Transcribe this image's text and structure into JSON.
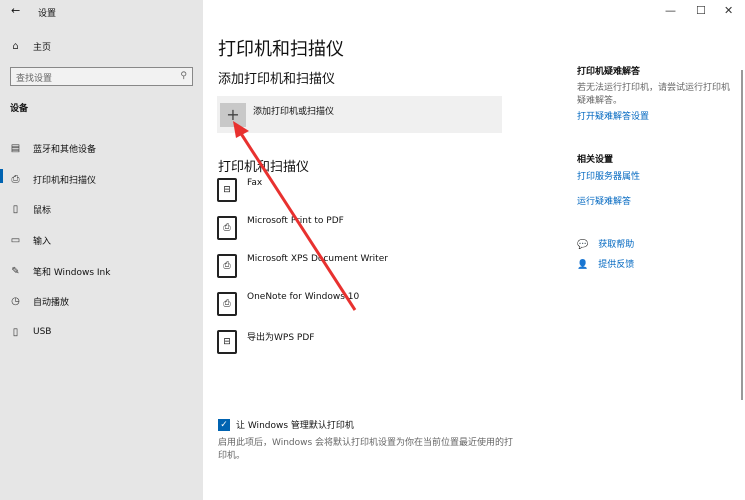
{
  "window": {
    "title": "设置",
    "minimize": "—",
    "maximize": "☐",
    "close": "✕"
  },
  "sidebar": {
    "back": "←",
    "home": "主页",
    "search_placeholder": "查找设置",
    "section": "设备",
    "items": [
      {
        "label": "蓝牙和其他设备",
        "icon": "bluetooth-devices-icon",
        "glyph": "▤"
      },
      {
        "label": "打印机和扫描仪",
        "icon": "printer-icon",
        "glyph": "⎙",
        "selected": true
      },
      {
        "label": "鼠标",
        "icon": "mouse-icon",
        "glyph": "▯"
      },
      {
        "label": "输入",
        "icon": "keyboard-icon",
        "glyph": "▭"
      },
      {
        "label": "笔和 Windows Ink",
        "icon": "pen-icon",
        "glyph": "✎"
      },
      {
        "label": "自动播放",
        "icon": "autoplay-icon",
        "glyph": "◷"
      },
      {
        "label": "USB",
        "icon": "usb-icon",
        "glyph": "▯"
      }
    ]
  },
  "main": {
    "title": "打印机和扫描仪",
    "add_section": "添加打印机和扫描仪",
    "add_label": "添加打印机或扫描仪",
    "list_section": "打印机和扫描仪",
    "printers": [
      {
        "name": "Fax",
        "icon": "fax-printer-icon"
      },
      {
        "name": "Microsoft Print to PDF",
        "icon": "document-printer-icon"
      },
      {
        "name": "Microsoft XPS Document Writer",
        "icon": "document-printer-icon"
      },
      {
        "name": "OneNote for Windows 10",
        "icon": "document-printer-icon"
      },
      {
        "name": "导出为WPS PDF",
        "icon": "printer-icon"
      }
    ],
    "default_checkbox": {
      "label": "让 Windows 管理默认打印机",
      "checked": true
    },
    "default_desc": "启用此项后，Windows 会将默认打印机设置为你在当前位置最近使用的打印机。"
  },
  "right": {
    "trouble_title": "打印机疑难解答",
    "trouble_desc": "若无法运行打印机，请尝试运行打印机疑难解答。",
    "trouble_link": "打开疑难解答设置",
    "related_title": "相关设置",
    "related_links": [
      "打印服务器属性",
      "运行疑难解答"
    ],
    "help": "获取帮助",
    "feedback": "提供反馈"
  },
  "colors": {
    "accent": "#0063b1",
    "link": "#0067c0",
    "annotation_arrow": "#e8312f"
  }
}
